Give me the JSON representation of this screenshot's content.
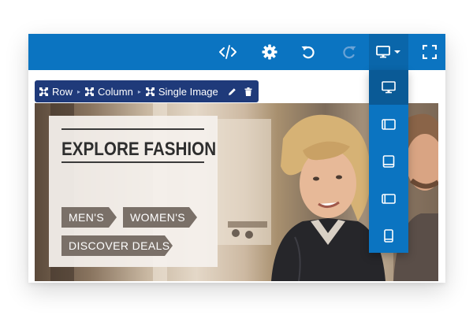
{
  "toolbar": {
    "icons": [
      "code-icon",
      "gear-icon",
      "undo-icon",
      "redo-icon",
      "monitor-icon",
      "chevron-down-icon",
      "fullscreen-icon"
    ],
    "accent_color": "#0b74c1"
  },
  "breadcrumb": {
    "items": [
      {
        "label": "Row",
        "icon": "move-icon"
      },
      {
        "label": "Column",
        "icon": "move-icon"
      },
      {
        "label": "Single Image",
        "icon": "move-icon"
      }
    ],
    "actions": [
      "pencil-icon",
      "trash-icon"
    ],
    "color": "#1f3a7a"
  },
  "hero": {
    "headline": "EXPLORE FASHION",
    "tags": [
      {
        "label": "MEN'S"
      },
      {
        "label": "WOMEN'S"
      },
      {
        "label": "DISCOVER DEALS"
      }
    ]
  },
  "device_menu": {
    "items": [
      {
        "icon": "desktop-icon",
        "active": true
      },
      {
        "icon": "tablet-landscape-icon",
        "active": false
      },
      {
        "icon": "laptop-icon",
        "active": false
      },
      {
        "icon": "tablet-landscape-sidebar-icon",
        "active": false
      },
      {
        "icon": "phone-icon",
        "active": false
      }
    ]
  }
}
